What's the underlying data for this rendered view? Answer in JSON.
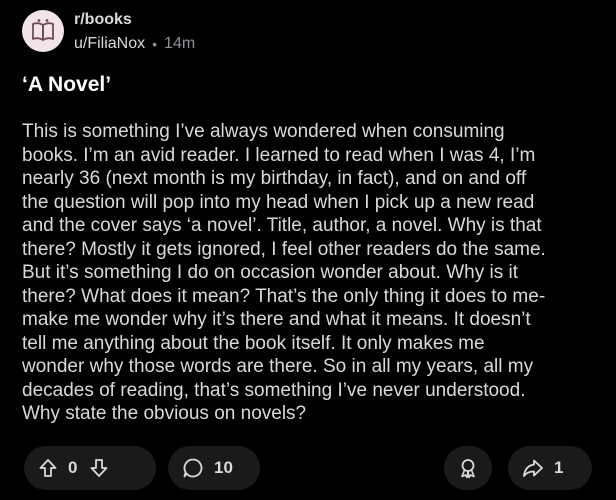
{
  "post": {
    "subreddit": "r/books",
    "author": "u/FiliaNox",
    "separator": "•",
    "age": "14m",
    "title": "‘A Novel’",
    "body": "This is something I’ve always wondered when consuming\nbooks. I’m an avid reader. I learned to read when I was 4, I’m\nnearly 36 (next month is my birthday, in fact), and on and off\nthe question will pop into my head when I pick up a new read\nand the cover says ‘a novel’. Title, author, a novel. Why is that\nthere? Mostly it gets ignored, I feel other readers do the same.\nBut it’s something I do on occasion wonder about. Why is it\nthere? What does it mean? That’s the only thing it does to me-\nmake me wonder why it’s there and what it means. It doesn’t\ntell me anything about the book itself. It only makes me\nwonder why those words are there. So in all my years, all my\ndecades of reading, that’s something I’ve never understood.\nWhy state the obvious on novels?"
  },
  "actions": {
    "votes": "0",
    "comments": "10",
    "shares": "1"
  },
  "icons": {
    "avatar": "subreddit-avatar-icon",
    "upvote": "upvote-arrow-icon",
    "downvote": "downvote-arrow-icon",
    "comment": "comment-bubble-icon",
    "award": "award-icon",
    "share": "share-arrow-icon"
  },
  "colors": {
    "background": "#000000",
    "pill": "#1a1a1b",
    "text": "#d7dadc",
    "muted": "#8b9196",
    "avatar_bg": "#f3e4ea"
  }
}
